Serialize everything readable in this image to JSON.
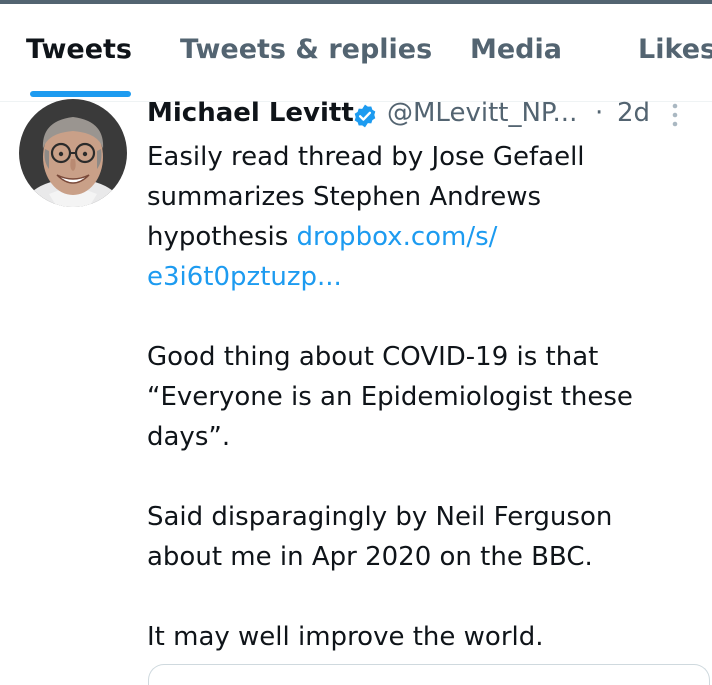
{
  "tabs": [
    {
      "label": "Tweets",
      "active": true
    },
    {
      "label": "Tweets & replies",
      "active": false
    },
    {
      "label": "Media",
      "active": false
    },
    {
      "label": "Likes",
      "active": false
    }
  ],
  "tweet": {
    "author": {
      "display_name": "Michael Levitt",
      "verified": true,
      "handle": "@MLevitt_NP...",
      "separator": "·",
      "time": "2d"
    },
    "lines": {
      "l1": "Easily read thread by Jose Gefaell",
      "l2": "summarizes Stephen Andrews",
      "l3_text": "hypothesis ",
      "l3_link": "dropbox.com/s/",
      "l4_link": "e3i6t0pztuzp...",
      "l5": "Good thing about COVID-19 is that",
      "l6": "“Everyone is an Epidemiologist these",
      "l7": "days”.",
      "l8": "Said disparagingly by Neil Ferguson",
      "l9": "about me in Apr 2020 on the BBC.",
      "l10": "It may well improve the world."
    }
  },
  "colors": {
    "accent": "#1d9bf0",
    "text_primary": "#0f1419",
    "text_secondary": "#536471",
    "divider": "#eff3f4"
  },
  "icons": {
    "verified": "verified-badge-icon",
    "more": "more-vertical-icon"
  }
}
